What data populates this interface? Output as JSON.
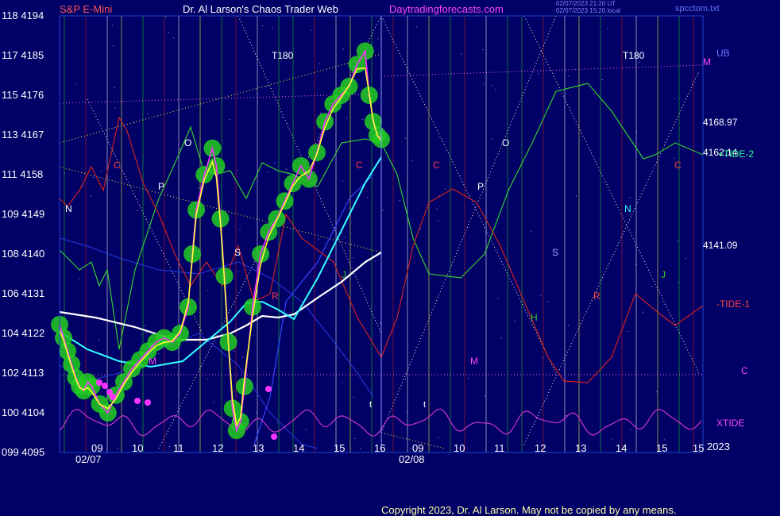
{
  "header": {
    "symbol": "S&P E-Mini",
    "title": "Dr. Al Larson's Chaos Trader Web",
    "site": "Daytradingforecasts.com",
    "stamp1": "02/07/2023 21:20 UT",
    "stamp2": "02/07/2023 15:20 local",
    "file": "spcctom.txt"
  },
  "y_axis": [
    {
      "label": "118 4194",
      "price": 4194
    },
    {
      "label": "117 4185",
      "price": 4185
    },
    {
      "label": "115 4176",
      "price": 4176
    },
    {
      "label": "113 4167",
      "price": 4167
    },
    {
      "label": "111 4158",
      "price": 4158
    },
    {
      "label": "109 4149",
      "price": 4149
    },
    {
      "label": "108 4140",
      "price": 4140
    },
    {
      "label": "106 4131",
      "price": 4131
    },
    {
      "label": "104 4122",
      "price": 4122
    },
    {
      "label": "102 4113",
      "price": 4113
    },
    {
      "label": "100 4104",
      "price": 4104
    },
    {
      "label": "099 4095",
      "price": 4095
    }
  ],
  "x_axis": {
    "hours": [
      "09",
      "10",
      "11",
      "12",
      "13",
      "14",
      "15",
      "16",
      "09",
      "10",
      "11",
      "12",
      "13",
      "14",
      "15",
      "15"
    ],
    "dates": [
      "02/07",
      "02/08"
    ],
    "year": "2023"
  },
  "right_labels": {
    "ub": "UB",
    "m": "M",
    "v1": "4168.97",
    "v2": "4162.14",
    "tide2": "+TIDE-2",
    "v3": "4141.09",
    "tide1": "-TIDE-1",
    "c": "C",
    "xtide": "XTIDE"
  },
  "markers": {
    "t180a": "T180",
    "t180b": "T180",
    "N": "N",
    "C": "C",
    "P": "P",
    "O": "O",
    "S": "S",
    "J": "J",
    "M": "M",
    "R": "R",
    "H": "H",
    "t": "t"
  },
  "copyright": "Copyright 2023, Dr. Al Larson. May not be copied by any means.",
  "colors": {
    "background": "#000066",
    "price_glow": "#22cc22",
    "price": "#ff33ff",
    "fast_ma": "#ffff33",
    "mid_ma": "#33ffff",
    "slow_ma": "#ffffff",
    "tide2": "#33cc33",
    "tide1": "#cc2222",
    "xtide": "#cc33cc",
    "envelope": "#2233cc"
  },
  "chart_data": {
    "type": "line",
    "title": "S&P E-Mini",
    "ylim": [
      4095,
      4194
    ],
    "series": [
      {
        "name": "S&P E-Mini",
        "x": [
          0,
          0.1,
          0.2,
          0.3,
          0.4,
          0.5,
          0.6,
          0.7,
          0.8,
          1.0,
          1.2,
          1.4,
          1.6,
          1.8,
          2.0,
          2.2,
          2.4,
          2.6,
          2.8,
          3.0,
          3.2,
          3.3,
          3.4,
          3.6,
          3.8,
          3.9,
          4.0,
          4.1,
          4.2,
          4.3,
          4.4,
          4.5,
          4.6,
          4.8,
          5.0,
          5.2,
          5.4,
          5.6,
          5.8,
          6.0,
          6.2,
          6.4,
          6.6,
          6.8,
          7.0,
          7.2,
          7.4,
          7.6,
          7.7,
          7.8,
          7.9,
          8.0
        ],
        "values": [
          4124,
          4121,
          4118,
          4115,
          4112,
          4110,
          4109,
          4111,
          4110,
          4106,
          4104,
          4108,
          4111,
          4114,
          4116,
          4118,
          4120,
          4121,
          4120,
          4122,
          4128,
          4140,
          4150,
          4158,
          4164,
          4160,
          4148,
          4135,
          4120,
          4105,
          4100,
          4102,
          4110,
          4128,
          4140,
          4145,
          4148,
          4152,
          4156,
          4160,
          4157,
          4163,
          4170,
          4174,
          4176,
          4178,
          4183,
          4186,
          4176,
          4170,
          4167,
          4166
        ]
      }
    ]
  }
}
